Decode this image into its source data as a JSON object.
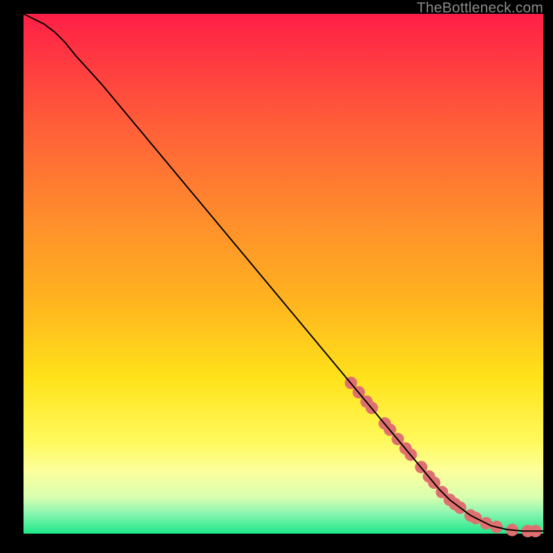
{
  "watermark": "TheBottleneck.com",
  "chart_data": {
    "type": "line",
    "title": "",
    "xlabel": "",
    "ylabel": "",
    "xlim": [
      0,
      100
    ],
    "ylim": [
      0,
      100
    ],
    "gradient_stops": [
      {
        "pct": 0,
        "color": "#ff1f47"
      },
      {
        "pct": 20,
        "color": "#ff5a3a"
      },
      {
        "pct": 38,
        "color": "#ff8a2d"
      },
      {
        "pct": 55,
        "color": "#ffb31f"
      },
      {
        "pct": 70,
        "color": "#ffe21a"
      },
      {
        "pct": 82,
        "color": "#fff95a"
      },
      {
        "pct": 88,
        "color": "#fcff9c"
      },
      {
        "pct": 93,
        "color": "#d8ffb0"
      },
      {
        "pct": 96,
        "color": "#8cf5b0"
      },
      {
        "pct": 100,
        "color": "#1ee88a"
      }
    ],
    "series": [
      {
        "name": "bottleneck-curve",
        "color": "#000000",
        "stroke_width": 2,
        "x": [
          0,
          2,
          4,
          6,
          8,
          10,
          15,
          20,
          30,
          40,
          50,
          60,
          70,
          80,
          82,
          86,
          90,
          93,
          96,
          97,
          98,
          99,
          100
        ],
        "y": [
          100,
          99,
          98,
          96.5,
          94.5,
          92,
          86.5,
          80.5,
          68.5,
          56.5,
          44.5,
          32.5,
          20.5,
          8.5,
          6.5,
          3.5,
          1.5,
          0.8,
          0.5,
          0.5,
          0.5,
          0.5,
          0.5
        ]
      }
    ],
    "markers": {
      "name": "highlighted-segment",
      "color": "#e07070",
      "radius": 9,
      "x": [
        63,
        64.5,
        66,
        67,
        69.5,
        70.5,
        72,
        73.5,
        74.5,
        76.5,
        78,
        79,
        80.5,
        82,
        83,
        84,
        86,
        87,
        89,
        91,
        94,
        97,
        98.5
      ],
      "y": [
        29.0,
        27.2,
        25.4,
        24.2,
        21.2,
        20.0,
        18.2,
        16.4,
        15.2,
        12.8,
        11.0,
        9.8,
        8.0,
        6.5,
        5.7,
        5.0,
        3.5,
        3.0,
        2.0,
        1.3,
        0.7,
        0.5,
        0.5
      ]
    }
  }
}
